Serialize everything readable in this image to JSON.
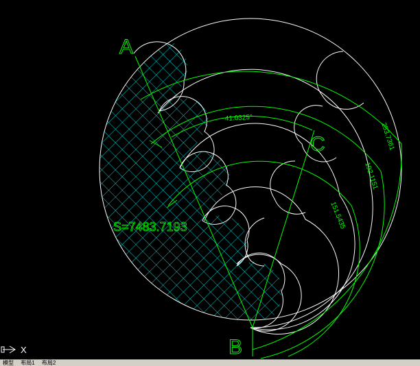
{
  "drawing": {
    "point_labels": [
      "A",
      "B",
      "C"
    ],
    "angle_dimension": "41.0325°",
    "arc_dimensions": [
      "253.7361",
      "192.1151",
      "151.5435"
    ],
    "area_label": "S=7483.7193"
  },
  "ucs_icon": {
    "axis_label": "X",
    "icon": "ucs-axis-icon"
  },
  "layout_tabs": [
    "模型",
    "布局1",
    "布局2"
  ],
  "colors": {
    "background": "#000000",
    "geometry": "#ffffff",
    "annotation": "#00ff00",
    "hatch": "#00ffff"
  }
}
